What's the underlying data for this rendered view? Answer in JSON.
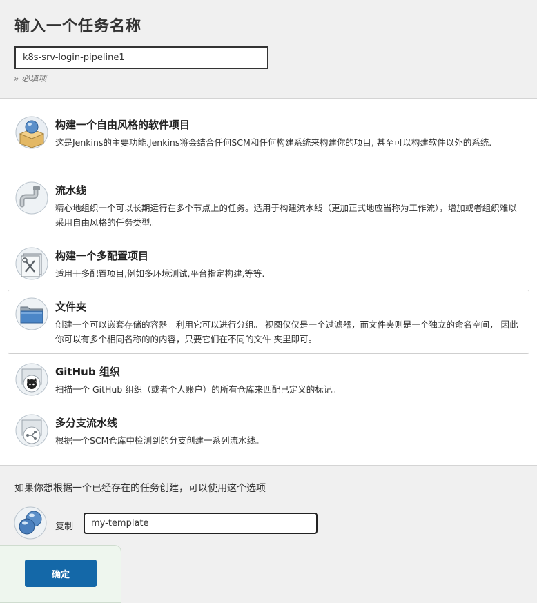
{
  "header": {
    "title": "输入一个任务名称",
    "name_value": "k8s-srv-login-pipeline1",
    "required_hint": "» 必填项"
  },
  "types": [
    {
      "title": "构建一个自由风格的软件项目",
      "desc": "这是Jenkins的主要功能.Jenkins将会结合任何SCM和任何构建系统来构建你的项目, 甚至可以构建软件以外的系统.",
      "icon": "freestyle-project-icon"
    },
    {
      "title": "流水线",
      "desc": "精心地组织一个可以长期运行在多个节点上的任务。适用于构建流水线（更加正式地应当称为工作流），增加或者组织难以采用自由风格的任务类型。",
      "icon": "pipeline-icon"
    },
    {
      "title": "构建一个多配置项目",
      "desc": "适用于多配置项目,例如多环境测试,平台指定构建,等等.",
      "icon": "multi-config-icon"
    },
    {
      "title": "文件夹",
      "desc": "创建一个可以嵌套存储的容器。利用它可以进行分组。 视图仅仅是一个过滤器，而文件夹则是一个独立的命名空间， 因此你可以有多个相同名称的的内容，只要它们在不同的文件 夹里即可。",
      "icon": "folder-icon"
    },
    {
      "title": "GitHub 组织",
      "desc": "扫描一个 GitHub 组织（或者个人账户）的所有仓库来匹配已定义的标记。",
      "icon": "github-org-icon"
    },
    {
      "title": "多分支流水线",
      "desc": "根据一个SCM仓库中检测到的分支创建一系列流水线。",
      "icon": "multibranch-icon"
    }
  ],
  "copy": {
    "hint": "如果你想根据一个已经存在的任务创建，可以使用这个选项",
    "label": "复制",
    "value": "my-template",
    "icon": "copy-job-icon"
  },
  "ok_button": "确定",
  "selected_type_index": 3
}
